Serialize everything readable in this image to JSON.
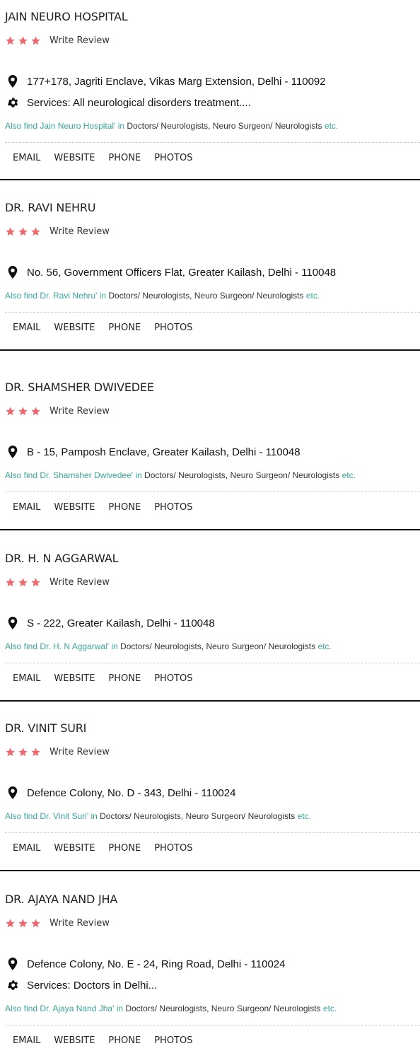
{
  "colors": {
    "star": "#ea6a6f",
    "teal": "#3aa399",
    "divider": "#111111"
  },
  "common": {
    "write_review": "Write Review",
    "also_find_prefix": "Also find ",
    "also_find_suffix": " in ",
    "category_1": "Doctors/ Neurologists",
    "category_2": "Neuro Surgeon/ Neurologists",
    "sep": ", ",
    "etc": "etc.",
    "actions": {
      "email": "EMAIL",
      "website": "WEBSITE",
      "phone": "PHONE",
      "photos": "PHOTOS"
    },
    "icons": {
      "location": "map-pin-icon",
      "services": "gear-icon",
      "star": "star-icon"
    },
    "rating_stars": 3
  },
  "listings": [
    {
      "name": "JAIN NEURO HOSPITAL",
      "address": "177+178, Jagriti Enclave, Vikas Marg Extension, Delhi - 110092",
      "services": "Services: All neurological disorders treatment....",
      "also_name": "Jain Neuro Hospital'"
    },
    {
      "name": "DR. RAVI NEHRU",
      "address": "No. 56, Government Officers Flat, Greater Kailash, Delhi - 110048",
      "services": "",
      "also_name": "Dr. Ravi Nehru'"
    },
    {
      "name": "DR. SHAMSHER DWIVEDEE",
      "address": "B - 15, Pamposh Enclave, Greater Kailash, Delhi - 110048",
      "services": "",
      "also_name": "Dr. Shamsher Dwivedee'"
    },
    {
      "name": "DR. H. N AGGARWAL",
      "address": "S - 222, Greater Kailash, Delhi - 110048",
      "services": "",
      "also_name": "Dr. H. N Aggarwal'"
    },
    {
      "name": "DR. VINIT SURI",
      "address": "Defence Colony, No. D - 343, Delhi - 110024",
      "services": "",
      "also_name": "Dr. Vinit Suri'"
    },
    {
      "name": "DR. AJAYA NAND JHA",
      "address": "Defence Colony, No. E - 24, Ring Road, Delhi - 110024",
      "services": "Services: Doctors in Delhi...",
      "also_name": "Dr. Ajaya Nand Jha'"
    }
  ]
}
